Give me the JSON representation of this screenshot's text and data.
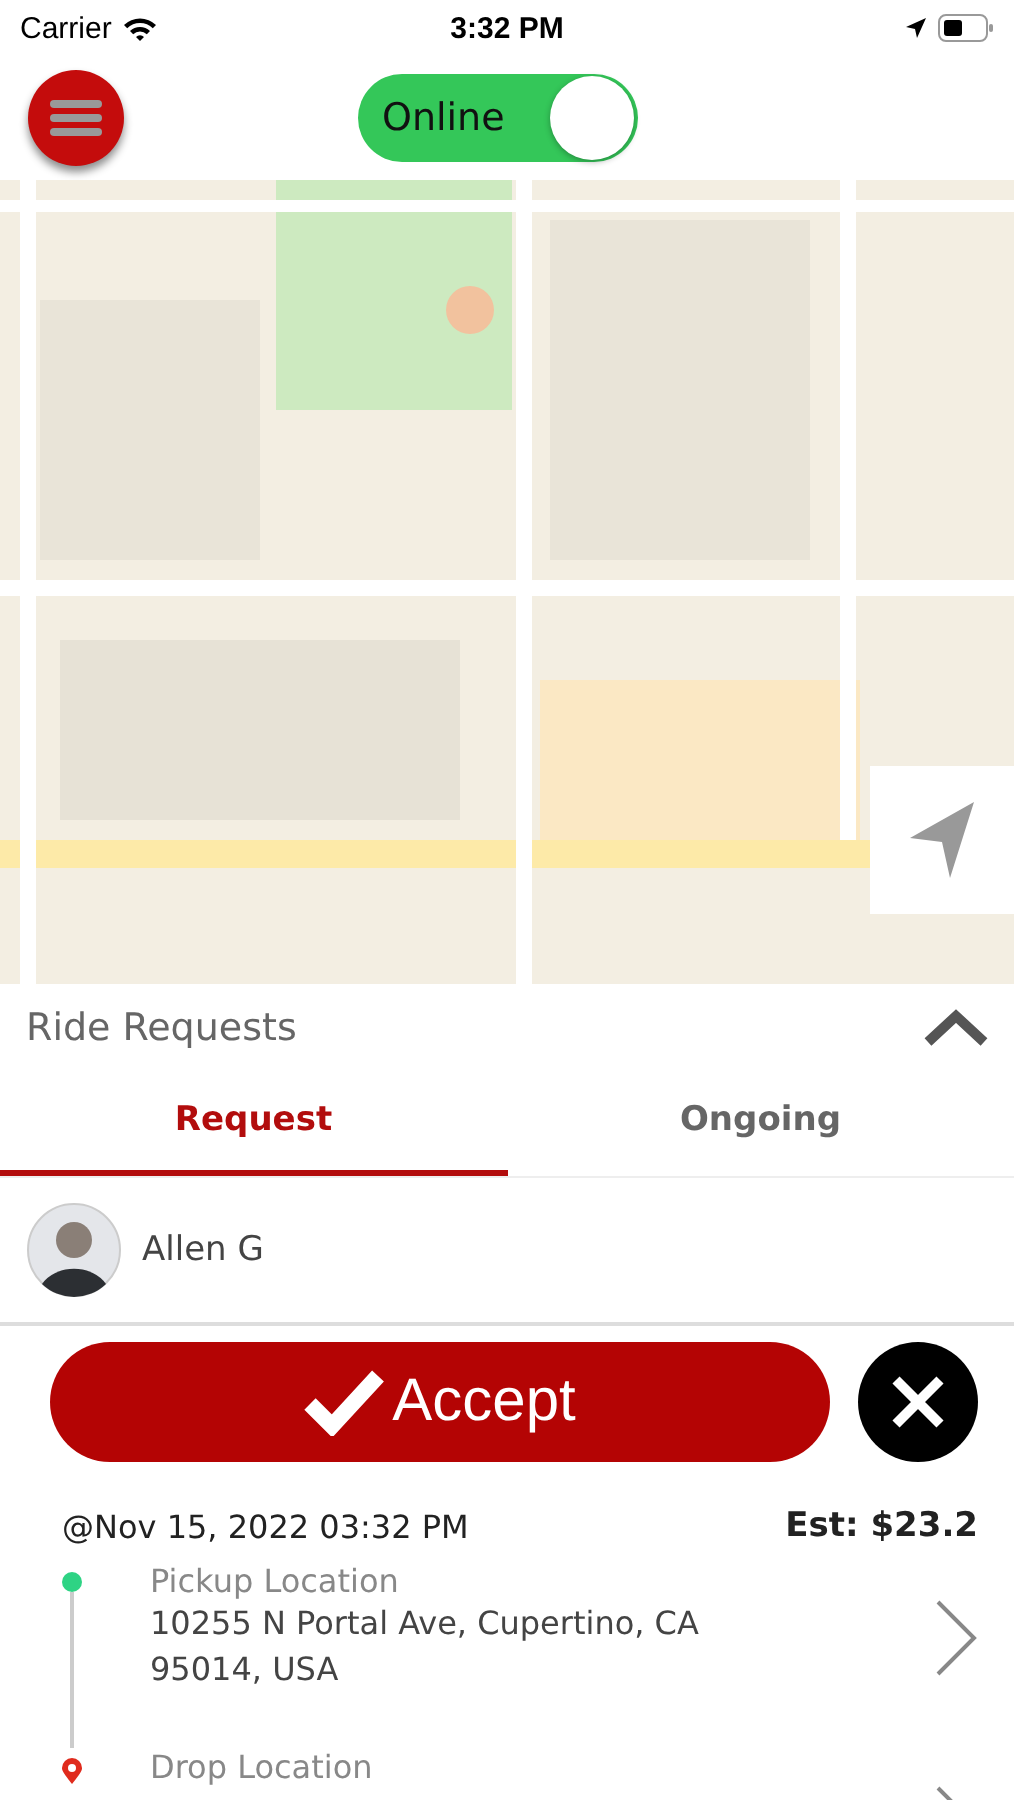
{
  "status_bar": {
    "carrier": "Carrier",
    "time": "3:32 PM"
  },
  "header": {
    "online_toggle": {
      "label": "Online",
      "on": true
    }
  },
  "panel": {
    "title": "Ride Requests",
    "expanded": true
  },
  "tabs": [
    {
      "label": "Request",
      "selected": true
    },
    {
      "label": "Ongoing",
      "selected": false
    }
  ],
  "rider": {
    "name": "Allen G"
  },
  "actions": {
    "accept": "Accept"
  },
  "trip": {
    "date": "@Nov 15, 2022 03:32 PM",
    "estimate": "Est: $23.2",
    "stops": [
      {
        "kind": "pickup",
        "label": "Pickup Location",
        "address": "10255 N Portal Ave, Cupertino, CA 95014, USA"
      },
      {
        "kind": "drop",
        "label": "Drop Location"
      }
    ]
  }
}
